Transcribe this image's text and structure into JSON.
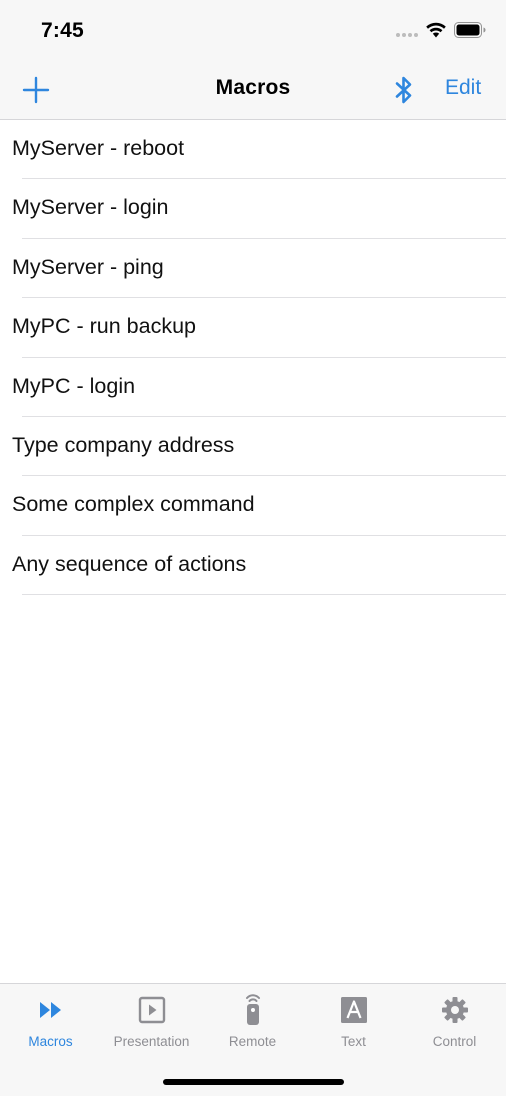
{
  "status_bar": {
    "time": "7:45"
  },
  "nav": {
    "title": "Macros",
    "edit_label": "Edit"
  },
  "macros": [
    "MyServer - reboot",
    "MyServer - login",
    "MyServer - ping",
    "MyPC - run backup",
    "MyPC - login",
    "Type company address",
    "Some complex command",
    "Any sequence of actions"
  ],
  "tabs": [
    {
      "label": "Macros",
      "icon": "fast-forward-icon",
      "active": true
    },
    {
      "label": "Presentation",
      "icon": "play-square-icon",
      "active": false
    },
    {
      "label": "Remote",
      "icon": "remote-control-icon",
      "active": false
    },
    {
      "label": "Text",
      "icon": "letter-a-icon",
      "active": false
    },
    {
      "label": "Control",
      "icon": "gear-icon",
      "active": false
    }
  ],
  "colors": {
    "accent": "#2e86de",
    "inactive": "#8e8e93",
    "bar_bg": "#f7f7f7"
  }
}
